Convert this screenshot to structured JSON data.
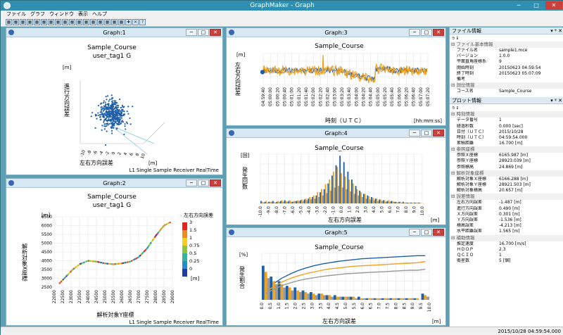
{
  "window": {
    "title": "GraphMaker - Graph",
    "min": "─",
    "max": "□",
    "close": "✕"
  },
  "menu": [
    "ファイル",
    "グラフ",
    "ウィンドウ",
    "表示",
    "ヘルプ"
  ],
  "toolbar": [
    "▦",
    "▦",
    "▦",
    "▦",
    "▦",
    "▦",
    "▦",
    "▦",
    "▦",
    "▦",
    "▦",
    "▦",
    "▦",
    "▦",
    "▦",
    "▦",
    "▦",
    "✚",
    "✕",
    "?"
  ],
  "colors": {
    "blue": "#1f5fa8",
    "orange": "#f0a21c",
    "gray": "#9a9a9a",
    "yellow": "#ffc000",
    "titlebar": "#2f8fb0"
  },
  "child_buttons": {
    "min": "─",
    "max": "□",
    "close": "✕"
  },
  "graphs": {
    "g1": {
      "title": "Graph:1",
      "chart_title": "Sample_Course",
      "subtitle": "user_tag1 G",
      "ylabel": "進行方向誤差",
      "yunit": "[m]",
      "xlabel": "左右方向誤差",
      "xunit": "[m]",
      "footer": "L1 Single Sample Receiver RealTime",
      "xticks": [
        "-10",
        "-8",
        "-6",
        "-4",
        "-2",
        "0",
        "2",
        "4",
        "6",
        "8",
        "10"
      ]
    },
    "g2": {
      "title": "Graph:2",
      "chart_title": "Sample_Course",
      "subtitle": "user_tag1 G",
      "yunit": "[m]",
      "ylabel": "解析対象X座標",
      "xlabel": "解析対象Y座標",
      "xunit": "[m]",
      "footer": "L1 Single Sample Receiver RealTime",
      "legend_title": "左右方向誤差",
      "legend_unit": "[m]",
      "legend_labels": [
        "3",
        "1.5",
        "1",
        "0.75",
        "0.5",
        "0.25",
        "0"
      ],
      "legend_colors": [
        "#e8231a",
        "#f08a1c",
        "#f5d01a",
        "#8cc63f",
        "#2fb5a0",
        "#1f8fd0",
        "#1f3fa8"
      ],
      "yticks": [
        "6500",
        "6000",
        "5500",
        "5000",
        "4500",
        "4000",
        "3500",
        "3000",
        "2500"
      ],
      "xticks": [
        "22000",
        "22500",
        "23000",
        "23500",
        "24000",
        "24500",
        "25000",
        "25500",
        "26000",
        "26500",
        "27000",
        "27500",
        "28000",
        "28500",
        "29000"
      ]
    },
    "g3": {
      "title": "Graph:3",
      "chart_title": "Sample_Course",
      "yunit": "[m]",
      "ylabel": "左右方向誤差",
      "xlabel": "時刻（ＵＴＣ）",
      "xunit": "[hh:mm:ss]",
      "xticks": [
        "04:59:40",
        "05:00:00",
        "05:00:20",
        "05:00:40",
        "05:01:00",
        "05:01:20",
        "05:01:40",
        "05:02:00",
        "05:02:20",
        "05:02:40",
        "05:03:00",
        "05:03:20",
        "05:03:40",
        "05:04:00",
        "05:04:20",
        "05:04:40",
        "05:05:00",
        "05:05:20",
        "05:05:40",
        "05:06:00",
        "05:06:20",
        "05:06:40",
        "05:07:00",
        "05:07:20"
      ]
    },
    "g4": {
      "title": "Graph:4",
      "chart_title": "Sample_Course",
      "yunit": "[回]",
      "ylabel": "発生回数",
      "xlabel": "左右方向誤差",
      "xunit": "[m]",
      "xticks": [
        "-10.0",
        "-9.0",
        "-8.0",
        "-7.0",
        "-6.0",
        "-5.0",
        "-4.0",
        "-3.0",
        "-2.0",
        "-1.0",
        "0.0",
        "1.0",
        "2.0",
        "3.0",
        "4.0",
        "5.0",
        "6.0",
        "7.0",
        "8.0",
        "9.0",
        "10.0"
      ]
    },
    "g5": {
      "title": "Graph:5",
      "chart_title": "Sample_Course",
      "yunit": "[%]",
      "ylabel": "発生割合",
      "xlabel": "左右方向誤差",
      "xunit": "[m]",
      "xticks": [
        "0.0",
        "0.5",
        "1.0",
        "1.5",
        "2.0",
        "2.5",
        "3.0",
        "3.5",
        "4.0",
        "4.5",
        "5.0",
        "5.5",
        "6.0",
        "6.5",
        "7.0",
        "7.5",
        "8.0",
        "8.5",
        "9.0",
        "9.5",
        "10.0"
      ]
    }
  },
  "file_panel": {
    "header": "ファイル情報",
    "pin": "▾ ᵠ ✕",
    "tools": "᪁ ᵻ",
    "sections": [
      {
        "name": "⊟ ファイル基本情報",
        "rows": [
          [
            "ファイル名",
            "sample1.mce"
          ],
          [
            "バージョン",
            "1.0.0"
          ],
          [
            "平面直角座標系",
            "9"
          ],
          [
            "開始時刻",
            "20150623 04:59:54"
          ],
          [
            "終了時刻",
            "20150623 05:07:09"
          ],
          [
            "備考",
            ""
          ]
        ]
      },
      {
        "name": "⊟ 測位情報",
        "rows": [
          [
            "コース名",
            "Sample_Course"
          ]
        ]
      }
    ]
  },
  "plot_panel": {
    "header": "プロット情報",
    "pin": "▾ ᵠ ✕",
    "tools": "᪁ ᵻ",
    "sections": [
      {
        "name": "⊟ 時刻情報",
        "rows": [
          [
            "データ番号",
            "1"
          ],
          [
            "経過秒数",
            "0.000 [sec]"
          ],
          [
            "日付（ＵＴＣ）",
            "2015/10/28"
          ],
          [
            "時刻（ＵＴＣ）",
            "04:59:54.000"
          ],
          [
            "累積距離",
            "16.700 [m]"
          ]
        ]
      },
      {
        "name": "⊟ 参照座標",
        "rows": [
          [
            "参照Ｘ座標",
            "6165.987 [m]"
          ],
          [
            "参照Ｙ座標",
            "28923.039 [m]"
          ],
          [
            "参照標高",
            "24.869 [m]"
          ]
        ]
      },
      {
        "name": "⊟ 解析対象座標",
        "rows": [
          [
            "解析対象Ｘ座標",
            "6166.288 [m]"
          ],
          [
            "解析対象Ｙ座標",
            "28921.503 [m]"
          ],
          [
            "解析対象標高",
            "20.657 [m]"
          ]
        ]
      },
      {
        "name": "⊟ 誤差情報",
        "rows": [
          [
            "左右方向誤差",
            "-1.487 [m]"
          ],
          [
            "進行方向誤差",
            "0.490 [m]"
          ],
          [
            "Ｘ方向誤差",
            "0.301 [m]"
          ],
          [
            "Ｙ方向誤差",
            "-1.536 [m]"
          ],
          [
            "標高誤差",
            "-4.213 [m]"
          ],
          [
            "水平距離誤差",
            "1.565 [m]"
          ]
        ]
      },
      {
        "name": "⊟ 補助情報",
        "rows": [
          [
            "推定速度",
            "16.700 [m/s]"
          ],
          [
            "ＨＤＯＰ",
            "2.3"
          ],
          [
            "ＱＣＩＯ",
            "1"
          ],
          [
            "衛星数",
            "5 [個]"
          ]
        ]
      }
    ]
  },
  "status": {
    "text": "2015/10/28 04:59:54.000"
  },
  "chart_data": [
    {
      "type": "scatter",
      "name": "Graph:1",
      "title": "Sample_Course",
      "subtitle": "user_tag1 G",
      "xlabel": "左右方向誤差",
      "ylabel": "進行方向誤差",
      "xlim": [
        -10,
        10
      ],
      "ylim": [
        -10,
        10
      ],
      "cluster_center": [
        0,
        0.5
      ],
      "cluster_spread": [
        2.5,
        4
      ]
    },
    {
      "type": "line",
      "name": "Graph:2",
      "title": "Sample_Course",
      "subtitle": "user_tag1 G",
      "xlabel": "解析対象Y座標",
      "ylabel": "解析対象X座標",
      "xlim": [
        22000,
        29000
      ],
      "ylim": [
        2500,
        6500
      ],
      "points": [
        [
          22300,
          2700
        ],
        [
          22700,
          3100
        ],
        [
          23100,
          3500
        ],
        [
          23500,
          3800
        ],
        [
          24000,
          4000
        ],
        [
          24500,
          3950
        ],
        [
          25000,
          3850
        ],
        [
          25500,
          3800
        ],
        [
          26000,
          3850
        ],
        [
          26500,
          3950
        ],
        [
          27000,
          4200
        ],
        [
          27500,
          4700
        ],
        [
          28000,
          5400
        ],
        [
          28500,
          6000
        ],
        [
          28900,
          6200
        ]
      ]
    },
    {
      "type": "line",
      "name": "Graph:3",
      "title": "Sample_Course",
      "xlabel": "時刻（ＵＴＣ）",
      "ylabel": "左右方向誤差",
      "series": [
        {
          "name": "",
          "color": "#f0a21c"
        },
        {
          "name": "",
          "color": "#1f5fa8"
        },
        {
          "name": "",
          "color": "#9a9a9a"
        }
      ]
    },
    {
      "type": "bar",
      "name": "Graph:4",
      "title": "Sample_Course",
      "xlabel": "左右方向誤差",
      "ylabel": "発生回数",
      "xlim": [
        -10,
        10
      ],
      "categories": [
        -10,
        -9.5,
        -9,
        -8.5,
        -8,
        -7.5,
        -7,
        -6.5,
        -6,
        -5.5,
        -5,
        -4.5,
        -4,
        -3.5,
        -3,
        -2.5,
        -2,
        -1.5,
        -1,
        -0.5,
        0,
        0.5,
        1,
        1.5,
        2,
        2.5,
        3,
        3.5,
        4,
        4.5,
        5,
        5.5,
        6,
        6.5,
        7,
        7.5,
        8,
        8.5,
        9,
        9.5,
        10
      ],
      "series": [
        {
          "name": "",
          "color": "#1f5fa8",
          "values": [
            3,
            2,
            2,
            3,
            2,
            3,
            4,
            3,
            2,
            3,
            4,
            5,
            6,
            8,
            10,
            14,
            18,
            25,
            35,
            48,
            60,
            52,
            40,
            30,
            22,
            16,
            12,
            10,
            8,
            6,
            5,
            4,
            3,
            3,
            2,
            2,
            2,
            1,
            1,
            1,
            1
          ]
        },
        {
          "name": "",
          "color": "#f0a21c",
          "values": [
            2,
            3,
            2,
            2,
            3,
            4,
            3,
            4,
            3,
            4,
            5,
            6,
            8,
            10,
            14,
            18,
            24,
            30,
            40,
            46,
            38,
            34,
            30,
            25,
            18,
            14,
            12,
            9,
            7,
            6,
            5,
            4,
            4,
            3,
            2,
            2,
            1,
            1,
            1,
            1,
            1
          ]
        },
        {
          "name": "",
          "color": "#9a9a9a",
          "values": [
            1,
            1,
            2,
            1,
            2,
            2,
            2,
            2,
            3,
            3,
            3,
            4,
            5,
            6,
            8,
            10,
            13,
            16,
            20,
            22,
            20,
            18,
            15,
            12,
            10,
            8,
            6,
            5,
            4,
            3,
            3,
            2,
            2,
            2,
            1,
            1,
            1,
            1,
            1,
            1,
            0
          ]
        }
      ]
    },
    {
      "type": "bar",
      "name": "Graph:5",
      "title": "Sample_Course",
      "xlabel": "左右方向誤差",
      "ylabel": "発生割合",
      "xlim": [
        0,
        10
      ],
      "categories": [
        0,
        0.5,
        1,
        1.5,
        2,
        2.5,
        3,
        3.5,
        4,
        4.5,
        5,
        5.5,
        6,
        6.5,
        7,
        7.5,
        8,
        8.5,
        9,
        9.5,
        10
      ],
      "series": [
        {
          "name": "",
          "color": "#1f5fa8",
          "values": [
            22,
            15,
            12,
            9,
            8,
            6,
            5,
            4,
            3,
            3,
            2,
            2,
            2,
            1,
            1,
            1,
            1,
            1,
            1,
            1,
            4
          ]
        },
        {
          "name": "",
          "color": "#f0a21c",
          "values": [
            18,
            12,
            10,
            8,
            6,
            5,
            4,
            4,
            3,
            2,
            2,
            2,
            1,
            1,
            1,
            1,
            1,
            1,
            1,
            1,
            3
          ]
        },
        {
          "name": "",
          "color": "#9a9a9a",
          "values": [
            14,
            10,
            8,
            6,
            5,
            4,
            3,
            3,
            2,
            2,
            2,
            1,
            1,
            1,
            1,
            1,
            1,
            1,
            1,
            0,
            2
          ]
        }
      ]
    }
  ]
}
